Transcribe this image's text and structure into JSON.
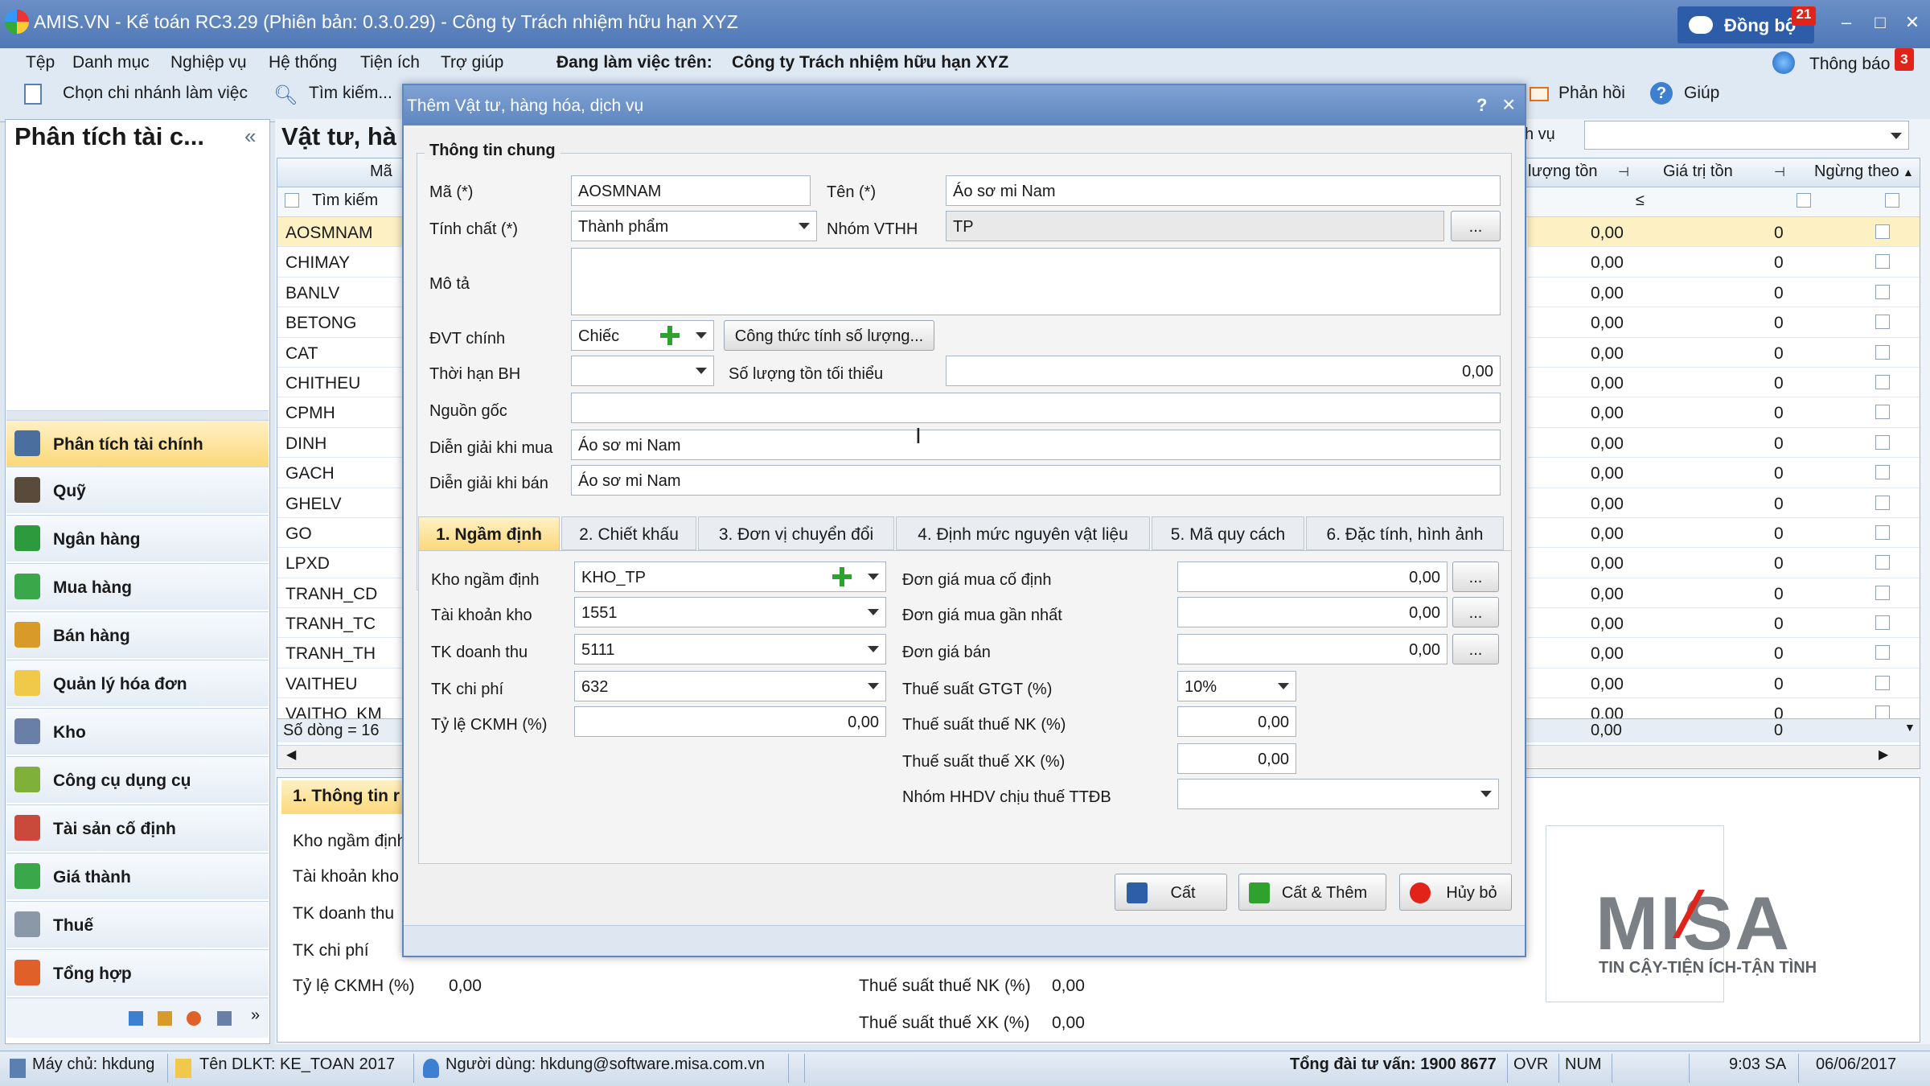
{
  "window": {
    "title": "AMIS.VN - Kế toán RC3.29 (Phiên bản: 0.3.0.29) - Công ty Trách nhiệm hữu hạn XYZ",
    "sync_label": "Đồng bộ",
    "sync_badge": "21"
  },
  "menu": {
    "items": [
      "Tệp",
      "Danh mục",
      "Nghiệp vụ",
      "Hệ thống",
      "Tiện ích",
      "Trợ giúp"
    ],
    "working_on_label": "Đang làm việc trên:",
    "company": "Công ty Trách nhiệm hữu hạn XYZ",
    "notify_label": "Thông báo",
    "notify_badge": "3"
  },
  "toolbar": {
    "branch": "Chọn chi nhánh làm việc",
    "search": "Tìm kiếm...",
    "feedback": "Phản hồi",
    "help": "Giúp"
  },
  "sidebar": {
    "title": "Phân tích tài c...",
    "collapse": "«",
    "items": [
      "Phân tích tài chính",
      "Quỹ",
      "Ngân hàng",
      "Mua hàng",
      "Bán hàng",
      "Quản lý hóa đơn",
      "Kho",
      "Công cụ dụng cụ",
      "Tài sản cố định",
      "Giá thành",
      "Thuế",
      "Tổng hợp"
    ]
  },
  "list": {
    "title": "Vật tư, hà",
    "col_code": "Mã",
    "search_label": "Tìm kiếm",
    "filter_label": "h vụ",
    "codes": [
      "AOSMNAM",
      "CHIMAY",
      "BANLV",
      "BETONG",
      "CAT",
      "CHITHEU",
      "CPMH",
      "DINH",
      "GACH",
      "GHELV",
      "GO",
      "LPXD",
      "TRANH_CD",
      "TRANH_TC",
      "TRANH_TH",
      "VAITHEU",
      "VAITHO_KM"
    ],
    "row_count": "Số dòng = 16",
    "col_qty": "lượng tồn",
    "col_value": "Giá trị tồn",
    "col_stop": "Ngừng theo",
    "qty_val": "0,00",
    "value_val": "0",
    "filter_le": "≤"
  },
  "detail": {
    "tab": "1. Thông tin r",
    "labels": [
      "Kho ngầm định",
      "Tài khoản kho",
      "TK doanh thu",
      "TK chi phí",
      "Tỷ lệ CKMH (%)"
    ],
    "ckmh_val": "0,00",
    "nk_label": "Thuế suất thuế NK (%)",
    "nk_val": "0,00",
    "xk_label": "Thuế suất thuế XK (%)",
    "xk_val": "0,00"
  },
  "misa": {
    "logo": "MISA",
    "slogan": "TIN CẬY-TIỆN ÍCH-TẬN TÌNH"
  },
  "dialog": {
    "title": "Thêm Vật tư, hàng hóa, dịch vụ",
    "help": "?",
    "close": "×",
    "group": "Thông tin chung",
    "ma_label": "Mã (*)",
    "ma": "AOSMNAM",
    "ten_label": "Tên (*)",
    "ten": "Áo sơ mi Nam",
    "tinhchat_label": "Tính chất (*)",
    "tinhchat": "Thành phẩm",
    "nhom_label": "Nhóm VTHH",
    "nhom": "TP",
    "ellipsis": "...",
    "mota_label": "Mô tả",
    "mota": "",
    "dvt_label": "ĐVT chính",
    "dvt": "Chiếc",
    "congthuc": "Công thức tính số lượng...",
    "bh_label": "Thời hạn BH",
    "bh": "",
    "sltoithieu_label": "Số lượng tồn tối thiểu",
    "sltoithieu": "0,00",
    "nguongoc_label": "Nguồn gốc",
    "nguongoc": "",
    "dgmua_label": "Diễn giải khi mua",
    "dgmua": "Áo sơ mi Nam",
    "dgban_label": "Diễn giải khi bán",
    "dgban": "Áo sơ mi Nam",
    "tabs": [
      "1. Ngầm định",
      "2. Chiết khấu",
      "3. Đơn vị chuyển đổi",
      "4. Định mức nguyên vật liệu",
      "5. Mã quy cách",
      "6. Đặc tính, hình ảnh"
    ],
    "kho_label": "Kho ngầm định",
    "kho": "KHO_TP",
    "tkkho_label": "Tài khoản kho",
    "tkkho": "1551",
    "tkdt_label": "TK doanh thu",
    "tkdt": "5111",
    "tkcp_label": "TK chi phí",
    "tkcp": "632",
    "ckmh_label": "Tỷ lệ CKMH (%)",
    "ckmh": "0,00",
    "dgcd_label": "Đơn giá mua cố định",
    "dgcd": "0,00",
    "dggn_label": "Đơn giá mua gần nhất",
    "dggn": "0,00",
    "dgb_label": "Đơn giá bán",
    "dgb": "0,00",
    "gtgt_label": "Thuế suất GTGT (%)",
    "gtgt": "10%",
    "nk_label": "Thuế suất thuế NK (%)",
    "nk": "0,00",
    "xk_label": "Thuế suất thuế XK (%)",
    "xk": "0,00",
    "ttdb_label": "Nhóm HHDV chịu thuế TTĐB",
    "ttdb": "",
    "btn_save": "Cất",
    "btn_save_add": "Cất & Thêm",
    "btn_cancel": "Hủy bỏ"
  },
  "status": {
    "server": "Máy chủ: hkdung",
    "db": "Tên DLKT: KE_TOAN 2017",
    "user": "Người dùng: hkdung@software.misa.com.vn",
    "hotline": "Tổng đài tư vấn: 1900 8677",
    "ovr": "OVR",
    "num": "NUM",
    "time": "9:03 SA",
    "date": "06/06/2017"
  }
}
